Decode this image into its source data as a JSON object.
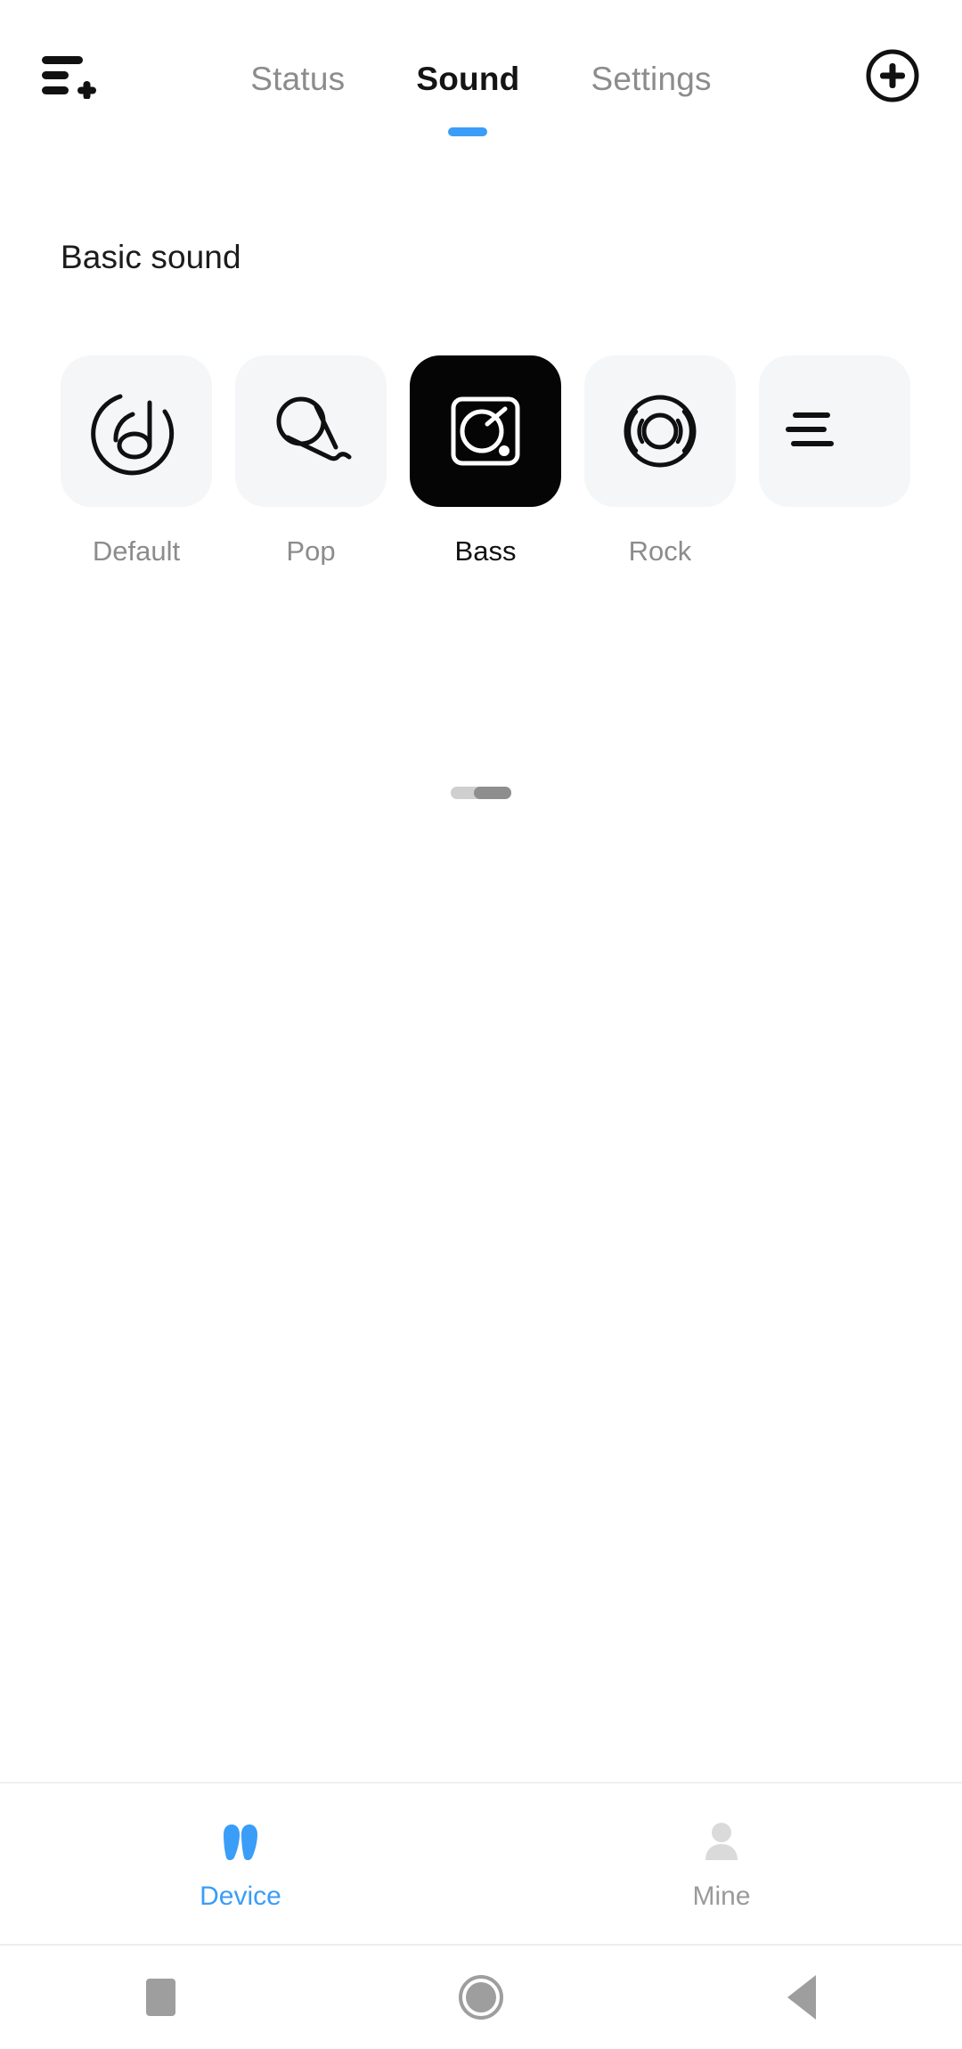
{
  "app": {
    "menu_icon": "list-add-icon",
    "add_icon": "plus-circle-icon"
  },
  "tabs": [
    {
      "label": "Status",
      "active": false
    },
    {
      "label": "Sound",
      "active": true
    },
    {
      "label": "Settings",
      "active": false
    }
  ],
  "content": {
    "section_title": "Basic sound",
    "presets": [
      {
        "label": "Default",
        "icon": "vinyl-music-note-icon",
        "selected": false
      },
      {
        "label": "Pop",
        "icon": "microphone-icon",
        "selected": false
      },
      {
        "label": "Bass",
        "icon": "speaker-amp-icon",
        "selected": true
      },
      {
        "label": "Rock",
        "icon": "speaker-waves-icon",
        "selected": false
      },
      {
        "label": "",
        "icon": "equalizer-lines-icon",
        "selected": false
      }
    ],
    "scrollbar": "horizontal-scroll-indicator"
  },
  "bottom_nav": [
    {
      "label": "Device",
      "icon": "earbuds-icon",
      "active": true
    },
    {
      "label": "Mine",
      "icon": "person-icon",
      "active": false
    }
  ],
  "system_nav": [
    {
      "icon": "recents-square-icon"
    },
    {
      "icon": "home-circle-icon"
    },
    {
      "icon": "back-triangle-icon"
    }
  ],
  "colors": {
    "accent": "#3a9df8",
    "selected_tile": "#050505",
    "tile": "#f4f6f8",
    "muted_text": "#8c8c8c",
    "primary_text": "#141414"
  }
}
